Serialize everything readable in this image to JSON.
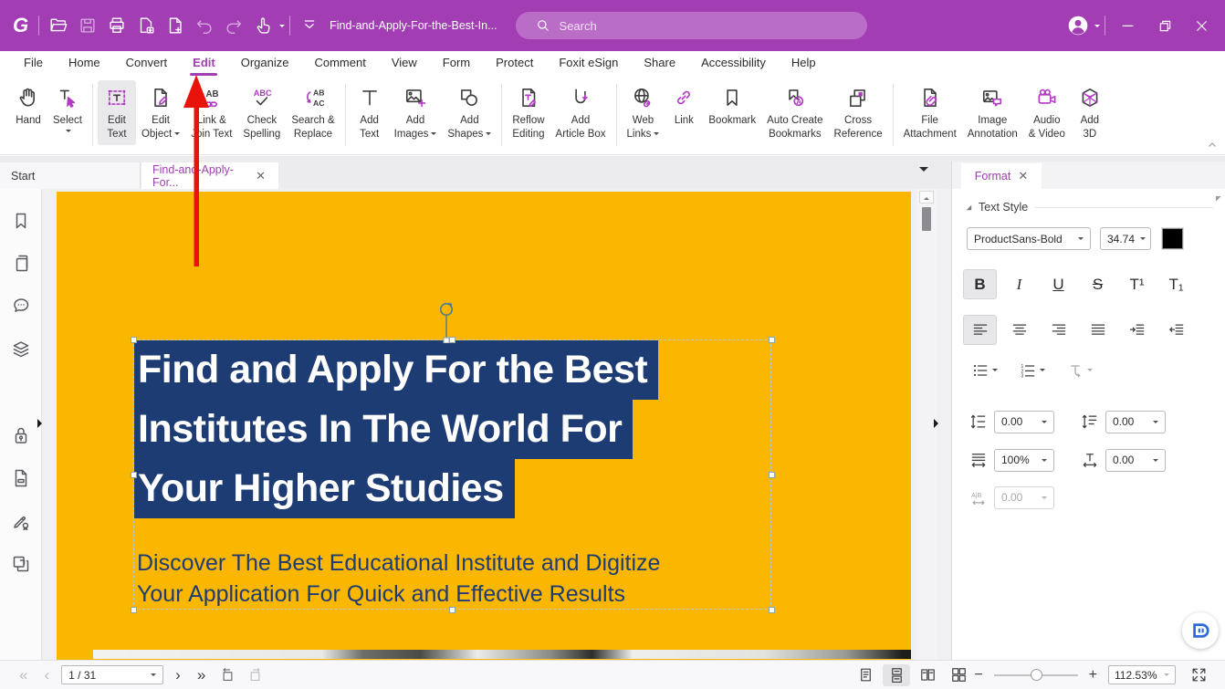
{
  "colors": {
    "titlebar_purple": "#A23DB4",
    "page_yellow": "#FBB700",
    "highlight_navy": "#1E3C74",
    "arrow_red": "#E8130A",
    "accent_purple": "#B23AC4"
  },
  "titlebar": {
    "filename": "Find-and-Apply-For-the-Best-In...",
    "search_placeholder": "Search",
    "left_icons": [
      "foxit-logo",
      "open-folder-icon",
      "save-icon",
      "print-icon",
      "export-page-icon",
      "new-page-icon",
      "undo-icon",
      "redo-icon",
      "touch-select-icon",
      "collapse-toolbar-icon"
    ],
    "right_icons": [
      "avatar",
      "minimize-icon",
      "restore-icon",
      "close-icon"
    ]
  },
  "menubar": {
    "items": [
      {
        "label": "File"
      },
      {
        "label": "Home"
      },
      {
        "label": "Convert"
      },
      {
        "label": "Edit",
        "active": true
      },
      {
        "label": "Organize"
      },
      {
        "label": "Comment"
      },
      {
        "label": "View"
      },
      {
        "label": "Form"
      },
      {
        "label": "Protect"
      },
      {
        "label": "Foxit eSign"
      },
      {
        "label": "Share"
      },
      {
        "label": "Accessibility"
      },
      {
        "label": "Help"
      }
    ]
  },
  "ribbon": {
    "groups": [
      {
        "items": [
          {
            "name": "hand",
            "icon": "hand-icon",
            "lines": [
              "Hand"
            ]
          },
          {
            "name": "select",
            "icon": "select-icon",
            "lines": [
              "Select"
            ],
            "dropdown": "below"
          }
        ]
      },
      {
        "items": [
          {
            "name": "edit-text",
            "icon": "edit-text-icon",
            "lines": [
              "Edit",
              "Text"
            ],
            "selected": true
          },
          {
            "name": "edit-object",
            "icon": "edit-object-icon",
            "lines": [
              "Edit",
              "Object"
            ],
            "dropdown": "inline"
          },
          {
            "name": "link-join-text",
            "icon": "link-join-text-icon",
            "lines": [
              "Link &",
              "Join Text"
            ]
          },
          {
            "name": "check-spelling",
            "icon": "check-spelling-icon",
            "lines": [
              "Check",
              "Spelling"
            ]
          },
          {
            "name": "search-replace",
            "icon": "search-replace-icon",
            "lines": [
              "Search &",
              "Replace"
            ]
          }
        ]
      },
      {
        "items": [
          {
            "name": "add-text",
            "icon": "add-text-icon",
            "lines": [
              "Add",
              "Text"
            ]
          },
          {
            "name": "add-images",
            "icon": "add-images-icon",
            "lines": [
              "Add",
              "Images"
            ],
            "dropdown": "inline"
          },
          {
            "name": "add-shapes",
            "icon": "add-shapes-icon",
            "lines": [
              "Add",
              "Shapes"
            ],
            "dropdown": "inline"
          }
        ]
      },
      {
        "items": [
          {
            "name": "reflow-editing",
            "icon": "reflow-editing-icon",
            "lines": [
              "Reflow",
              "Editing"
            ]
          },
          {
            "name": "add-article-box",
            "icon": "add-article-box-icon",
            "lines": [
              "Add",
              "Article Box"
            ]
          }
        ]
      },
      {
        "items": [
          {
            "name": "web-links",
            "icon": "web-links-icon",
            "lines": [
              "Web",
              "Links"
            ],
            "dropdown": "inline"
          },
          {
            "name": "link",
            "icon": "link-icon",
            "lines": [
              "Link"
            ]
          },
          {
            "name": "bookmark",
            "icon": "bookmark-icon",
            "lines": [
              "Bookmark"
            ]
          },
          {
            "name": "auto-create-bookmarks",
            "icon": "auto-create-bookmarks-icon",
            "lines": [
              "Auto Create",
              "Bookmarks"
            ]
          },
          {
            "name": "cross-reference",
            "icon": "cross-reference-icon",
            "lines": [
              "Cross",
              "Reference"
            ]
          }
        ]
      },
      {
        "items": [
          {
            "name": "file-attachment",
            "icon": "file-attachment-icon",
            "lines": [
              "File",
              "Attachment"
            ]
          },
          {
            "name": "image-annotation",
            "icon": "image-annotation-icon",
            "lines": [
              "Image",
              "Annotation"
            ]
          },
          {
            "name": "audio-video",
            "icon": "audio-video-icon",
            "lines": [
              "Audio",
              "& Video"
            ]
          },
          {
            "name": "add-3d",
            "icon": "add-3d-icon",
            "lines": [
              "Add",
              "3D"
            ]
          }
        ]
      }
    ]
  },
  "tabbar": {
    "tabs": [
      {
        "label": "Start",
        "active": false,
        "closable": false
      },
      {
        "label": "Find-and-Apply-For...",
        "active": true,
        "closable": true
      }
    ]
  },
  "sidebar": {
    "items": [
      {
        "name": "bookmarks",
        "icon": "bookmark-panel-icon"
      },
      {
        "name": "pages",
        "icon": "pages-icon"
      },
      {
        "name": "comments",
        "icon": "comments-icon"
      },
      {
        "name": "layers",
        "icon": "layers-icon"
      },
      {
        "name": "attachments",
        "icon": "attachment-icon"
      },
      {
        "name": "security",
        "icon": "lock-icon"
      },
      {
        "name": "destinations",
        "icon": "destinations-icon"
      },
      {
        "name": "signatures",
        "icon": "signature-icon"
      },
      {
        "name": "split-view",
        "icon": "split-view-icon"
      }
    ]
  },
  "document": {
    "heading_lines": [
      "Find and Apply For the Best",
      "Institutes In The World For",
      "Your Higher Studies"
    ],
    "subtext_lines": [
      "Discover The Best Educational Institute and Digitize",
      "Your Application For Quick and Effective Results"
    ]
  },
  "format_panel": {
    "tab_label": "Format",
    "close_label": "✕",
    "section_title": "Text Style",
    "font_name": "ProductSans-Bold",
    "font_size": "34.74",
    "style_buttons": [
      {
        "name": "bold",
        "glyph": "B",
        "selected": true
      },
      {
        "name": "italic",
        "glyph": "I"
      },
      {
        "name": "underline",
        "glyph": "U"
      },
      {
        "name": "strikethrough",
        "glyph": "S"
      },
      {
        "name": "superscript",
        "glyph": "T¹"
      },
      {
        "name": "subscript",
        "glyph": "T₁"
      }
    ],
    "align_buttons": [
      {
        "name": "align-left",
        "selected": true
      },
      {
        "name": "align-center"
      },
      {
        "name": "align-right"
      },
      {
        "name": "justify"
      },
      {
        "name": "indent-increase"
      },
      {
        "name": "indent-decrease"
      }
    ],
    "list_buttons": [
      {
        "name": "bullet-list",
        "dropdown": true
      },
      {
        "name": "numbered-list",
        "dropdown": true
      },
      {
        "name": "rotate-text",
        "dropdown": true,
        "disabled": true
      }
    ],
    "spacing_rows": [
      [
        {
          "name": "line-spacing",
          "icon": "line-spacing-icon",
          "value": "0.00"
        },
        {
          "name": "paragraph-spacing",
          "icon": "paragraph-spacing-icon",
          "value": "0.00"
        }
      ],
      [
        {
          "name": "horizontal-scale",
          "icon": "horizontal-scale-icon",
          "value": "100%"
        },
        {
          "name": "character-spacing",
          "icon": "character-spacing-icon",
          "value": "0.00"
        }
      ],
      [
        {
          "name": "word-spacing",
          "icon": "word-spacing-icon",
          "value": "0.00",
          "disabled": true
        }
      ]
    ]
  },
  "statusbar": {
    "first_page": "«",
    "prev_page": "‹",
    "next_page": "›",
    "last_page": "»",
    "page_indicator": "1 / 31",
    "zoom_value": "112.53%",
    "zoom_minus": "−",
    "zoom_plus": "+",
    "view_modes": [
      {
        "name": "single-page"
      },
      {
        "name": "continuous",
        "selected": true
      },
      {
        "name": "facing"
      },
      {
        "name": "continuous-facing"
      }
    ]
  }
}
